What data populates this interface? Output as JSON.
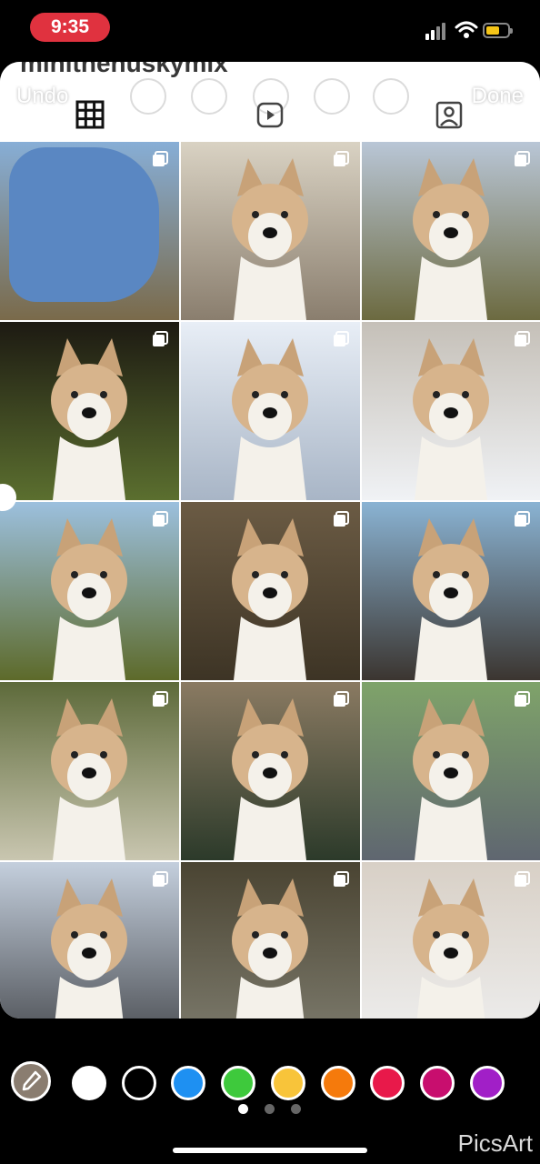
{
  "status_bar": {
    "time": "9:35",
    "icons": [
      "signal-icon",
      "wifi-icon",
      "battery-icon"
    ],
    "time_pill_color": "#e0323f",
    "battery_color": "#f5c518"
  },
  "header": {
    "username": "minithehuskymix",
    "undo_label": "Undo",
    "done_label": "Done",
    "tabs": [
      {
        "name": "grid",
        "icon": "grid-icon",
        "active": true
      },
      {
        "name": "reels",
        "icon": "reels-icon",
        "active": false
      },
      {
        "name": "tagged",
        "icon": "tagged-icon",
        "active": false
      }
    ]
  },
  "grid": {
    "items": [
      {
        "subject": "beach, obscured by blue scribble",
        "colors": [
          "#87aed6",
          "#7a6a4a"
        ]
      },
      {
        "subject": "husky on couch",
        "colors": [
          "#d9d2c3",
          "#8a7e6e"
        ]
      },
      {
        "subject": "husky on grassy field",
        "colors": [
          "#b9c6d6",
          "#6c6a40"
        ]
      },
      {
        "subject": "husky close-up with lights",
        "colors": [
          "#1d1a12",
          "#5b6f2f"
        ]
      },
      {
        "subject": "husky with bandana in snow",
        "colors": [
          "#e8eef6",
          "#a8b5c6"
        ]
      },
      {
        "subject": "husky in snowy woods",
        "colors": [
          "#c5c0b8",
          "#f0f2f5"
        ]
      },
      {
        "subject": "husky lying in grass by water",
        "colors": [
          "#9cc0de",
          "#5d6a2a"
        ]
      },
      {
        "subject": "husky nose close-up",
        "colors": [
          "#6b5b44",
          "#3d3425"
        ]
      },
      {
        "subject": "husky on rocks at beach",
        "colors": [
          "#8ab3d3",
          "#3b3530"
        ]
      },
      {
        "subject": "husky with tongue out",
        "colors": [
          "#5d6a3a",
          "#c9c6b0"
        ]
      },
      {
        "subject": "husky nose close-up 2",
        "colors": [
          "#8a7a62",
          "#2c3a2a"
        ]
      },
      {
        "subject": "husky on patio mat",
        "colors": [
          "#7fa36a",
          "#5f6670"
        ]
      },
      {
        "subject": "husky on street",
        "colors": [
          "#c4cfdd",
          "#4d5055"
        ]
      },
      {
        "subject": "husky smiling on lawn",
        "colors": [
          "#4a4432",
          "#7c7a6c"
        ]
      },
      {
        "subject": "husky on bed",
        "colors": [
          "#d8d0c6",
          "#eeeeee"
        ]
      }
    ]
  },
  "palette": {
    "eyedropper_icon": "eyedropper-icon",
    "colors": [
      "#ffffff",
      "#000000",
      "#1e90f2",
      "#3ec93c",
      "#f8c43a",
      "#f57a0c",
      "#e8194a",
      "#c80e6e",
      "#a11fc7"
    ],
    "page_dots": 3,
    "active_page": 0
  },
  "watermark": "PicsArt"
}
